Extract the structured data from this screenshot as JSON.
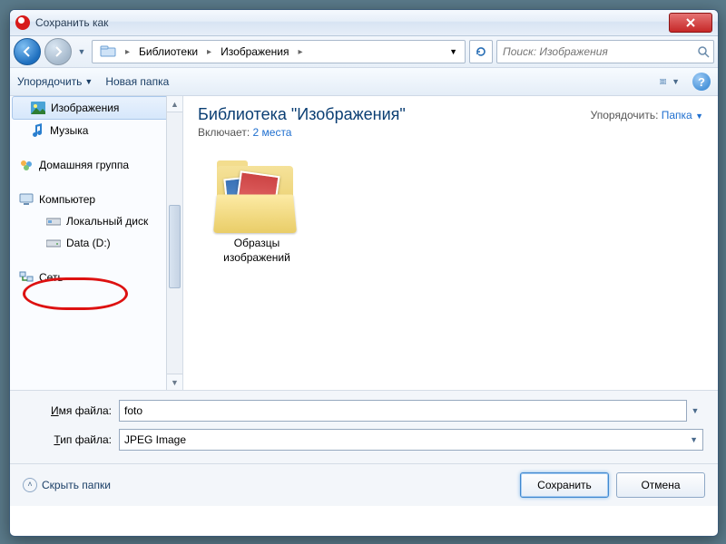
{
  "window": {
    "title": "Сохранить как"
  },
  "breadcrumb": {
    "seg1": "Библиотеки",
    "seg2": "Изображения"
  },
  "search": {
    "placeholder": "Поиск: Изображения"
  },
  "toolbar": {
    "organize": "Упорядочить",
    "new_folder": "Новая папка"
  },
  "sidebar": {
    "images": "Изображения",
    "music": "Музыка",
    "homegroup": "Домашняя группа",
    "computer": "Компьютер",
    "local_disk": "Локальный диск",
    "data_d": "Data (D:)",
    "network": "Сеть"
  },
  "content": {
    "library_title": "Библиотека \"Изображения\"",
    "includes_label": "Включает:",
    "includes_link": "2 места",
    "arrange_label": "Упорядочить:",
    "arrange_value": "Папка",
    "folder_line1": "Образцы",
    "folder_line2": "изображений"
  },
  "form": {
    "filename_label_pre": "И",
    "filename_label_rest": "мя файла:",
    "filename_value": "foto",
    "filetype_label_pre": "Т",
    "filetype_label_rest": "ип файла:",
    "filetype_value": "JPEG Image"
  },
  "footer": {
    "hide_folders": "Скрыть папки",
    "save": "Сохранить",
    "cancel": "Отмена"
  },
  "help_char": "?"
}
